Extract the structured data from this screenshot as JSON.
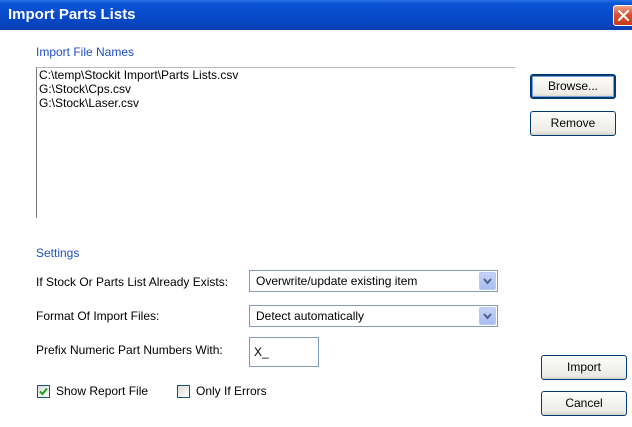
{
  "window": {
    "title": "Import Parts Lists",
    "titlebar_color": "#0a54d6",
    "close_icon": "close-icon"
  },
  "files_group": {
    "label": "Import File Names",
    "files": [
      "C:\\temp\\Stockit Import\\Parts Lists.csv",
      "G:\\Stock\\Cps.csv",
      "G:\\Stock\\Laser.csv"
    ],
    "browse_label": "Browse...",
    "remove_label": "Remove"
  },
  "settings_group": {
    "label": "Settings",
    "already_exists_label": "If Stock Or Parts List Already Exists:",
    "already_exists_value": "Overwrite/update existing item",
    "format_label": "Format Of Import Files:",
    "format_value": "Detect automatically",
    "prefix_label": "Prefix Numeric Part Numbers With:",
    "prefix_value": "X_"
  },
  "options": {
    "show_report_label": "Show Report File",
    "show_report_checked": true,
    "only_if_errors_label": "Only If Errors",
    "only_if_errors_checked": false
  },
  "actions": {
    "import_label": "Import",
    "cancel_label": "Cancel"
  },
  "colors": {
    "group_label": "#1f4fc4",
    "button_border": "#003c74",
    "checkmark": "#21a121"
  }
}
